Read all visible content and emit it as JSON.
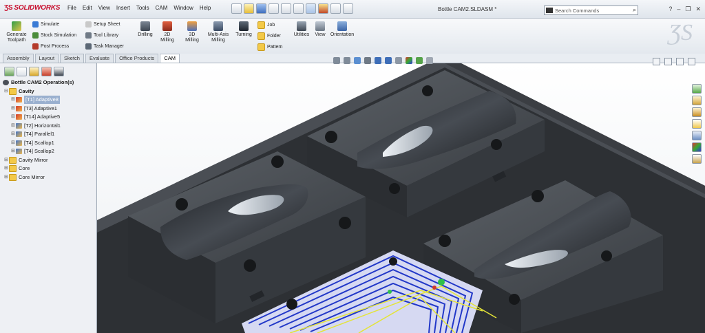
{
  "app": {
    "brand": "SOLIDWORKS",
    "doc_title": "Bottle CAM2.SLDASM *"
  },
  "menus": [
    "File",
    "Edit",
    "View",
    "Insert",
    "Tools",
    "CAM",
    "Window",
    "Help"
  ],
  "search": {
    "placeholder": "Search Commands"
  },
  "command_manager": {
    "generate": "Generate\nToolpath",
    "simulate": "Simulate",
    "stock_simulation": "Stock Simulation",
    "post_process": "Post Process",
    "setup_sheet": "Setup Sheet",
    "tool_library": "Tool Library",
    "task_manager": "Task Manager",
    "drilling": "Drilling",
    "milling_2d": "2D Milling",
    "milling_3d": "3D Milling",
    "multi_axis": "Multi-Axis\nMilling",
    "turning": "Turning",
    "job": "Job",
    "folder": "Folder",
    "pattern": "Pattern",
    "utilities": "Utilities",
    "view": "View",
    "orientation": "Orientation"
  },
  "tabs": [
    "Assembly",
    "Layout",
    "Sketch",
    "Evaluate",
    "Office Products",
    "CAM"
  ],
  "active_tab": "CAM",
  "tree": {
    "root": "Bottle CAM2 Operation(s)",
    "items": [
      {
        "label": "Cavity",
        "level": 1,
        "type": "folder",
        "bold": true
      },
      {
        "label": "[T1] Adaptive8",
        "level": 2,
        "type": "op",
        "selected": true
      },
      {
        "label": "[T3] Adaptive1",
        "level": 2,
        "type": "op"
      },
      {
        "label": "[T14] Adaptive5",
        "level": 2,
        "type": "op"
      },
      {
        "label": "[T2] Horizontal1",
        "level": 2,
        "type": "op2"
      },
      {
        "label": "[T4] Parallel1",
        "level": 2,
        "type": "op2"
      },
      {
        "label": "[T4] Scallop1",
        "level": 2,
        "type": "op2"
      },
      {
        "label": "[T4] Scallop2",
        "level": 2,
        "type": "op2"
      },
      {
        "label": "Cavity Mirror",
        "level": 1,
        "type": "folder"
      },
      {
        "label": "Core",
        "level": 1,
        "type": "folder"
      },
      {
        "label": "Core Mirror",
        "level": 1,
        "type": "folder"
      }
    ]
  },
  "colors": {
    "brand_red": "#c8102e",
    "toolpath_blue": "#2238c8",
    "mold_dark": "#3e4247",
    "selection": "#9ab0cf"
  }
}
